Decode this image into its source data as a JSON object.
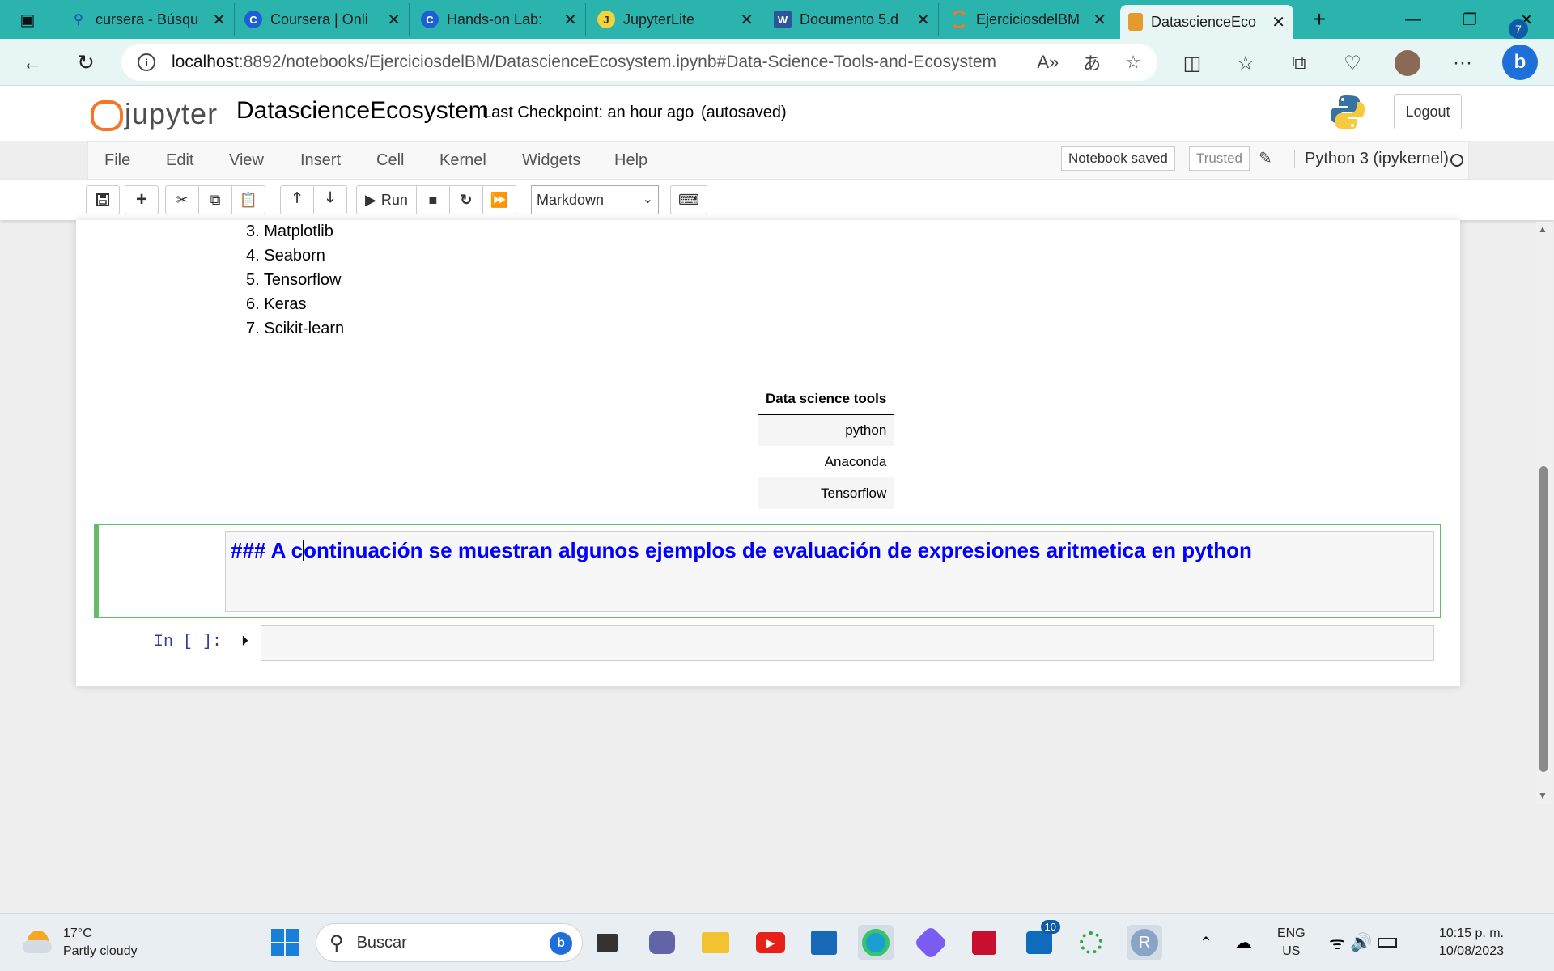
{
  "browser": {
    "tabs": [
      {
        "title": "cursera - Búsqu",
        "icon": "search-icon"
      },
      {
        "title": "Coursera | Onli",
        "icon": "coursera-icon"
      },
      {
        "title": "Hands-on Lab:",
        "icon": "coursera-icon"
      },
      {
        "title": "JupyterLite",
        "icon": "jupyterlite-icon"
      },
      {
        "title": "Documento 5.d",
        "icon": "word-icon"
      },
      {
        "title": "EjerciciosdelBM",
        "icon": "jupyter-icon"
      },
      {
        "title": "DatascienceEco",
        "icon": "notebook-icon"
      }
    ],
    "url_host": "localhost",
    "url_path": ":8892/notebooks/EjerciciosdelBM/DatascienceEcosystem.ipynb#Data-Science-Tools-and-Ecosystem"
  },
  "jupyter": {
    "logo_text": "jupyter",
    "notebook_title": "DatascienceEcosystem",
    "checkpoint": "Last Checkpoint: an hour ago",
    "autosaved": "(autosaved)",
    "logout": "Logout",
    "menus": [
      "File",
      "Edit",
      "View",
      "Insert",
      "Cell",
      "Kernel",
      "Widgets",
      "Help"
    ],
    "notebook_saved": "Notebook saved",
    "trusted": "Trusted",
    "kernel": "Python 3 (ipykernel)",
    "run_label": "Run",
    "cell_type": "Markdown"
  },
  "notebook": {
    "tools_list": [
      "3. Matplotlib",
      "4. Seaborn",
      "5. Tensorflow",
      "6. Keras",
      "7. Scikit-learn"
    ],
    "table": {
      "header": "Data science tools",
      "rows": [
        "python",
        "Anaconda",
        "Tensorflow"
      ]
    },
    "markdown_before_caret": "### A c",
    "markdown_after_caret": "ontinuación se muestran algunos ejemplos de evaluación de expresiones aritmetica en python",
    "code_prompt": "In [ ]:"
  },
  "taskbar": {
    "temperature": "17°C",
    "weather": "Partly cloudy",
    "search_placeholder": "Buscar",
    "lang_top": "ENG",
    "lang_bottom": "US",
    "time": "10:15 p. m.",
    "date": "10/08/2023",
    "notification_count": "7",
    "teams_badge": "10",
    "r_label": "R"
  },
  "colors": {
    "tab_bar": "#2bb3ad",
    "jupyter_orange": "#f37726",
    "markdown_blue": "#0000ff",
    "selected_cell_border": "#66bb6a",
    "prompt_blue": "#303f9f"
  }
}
